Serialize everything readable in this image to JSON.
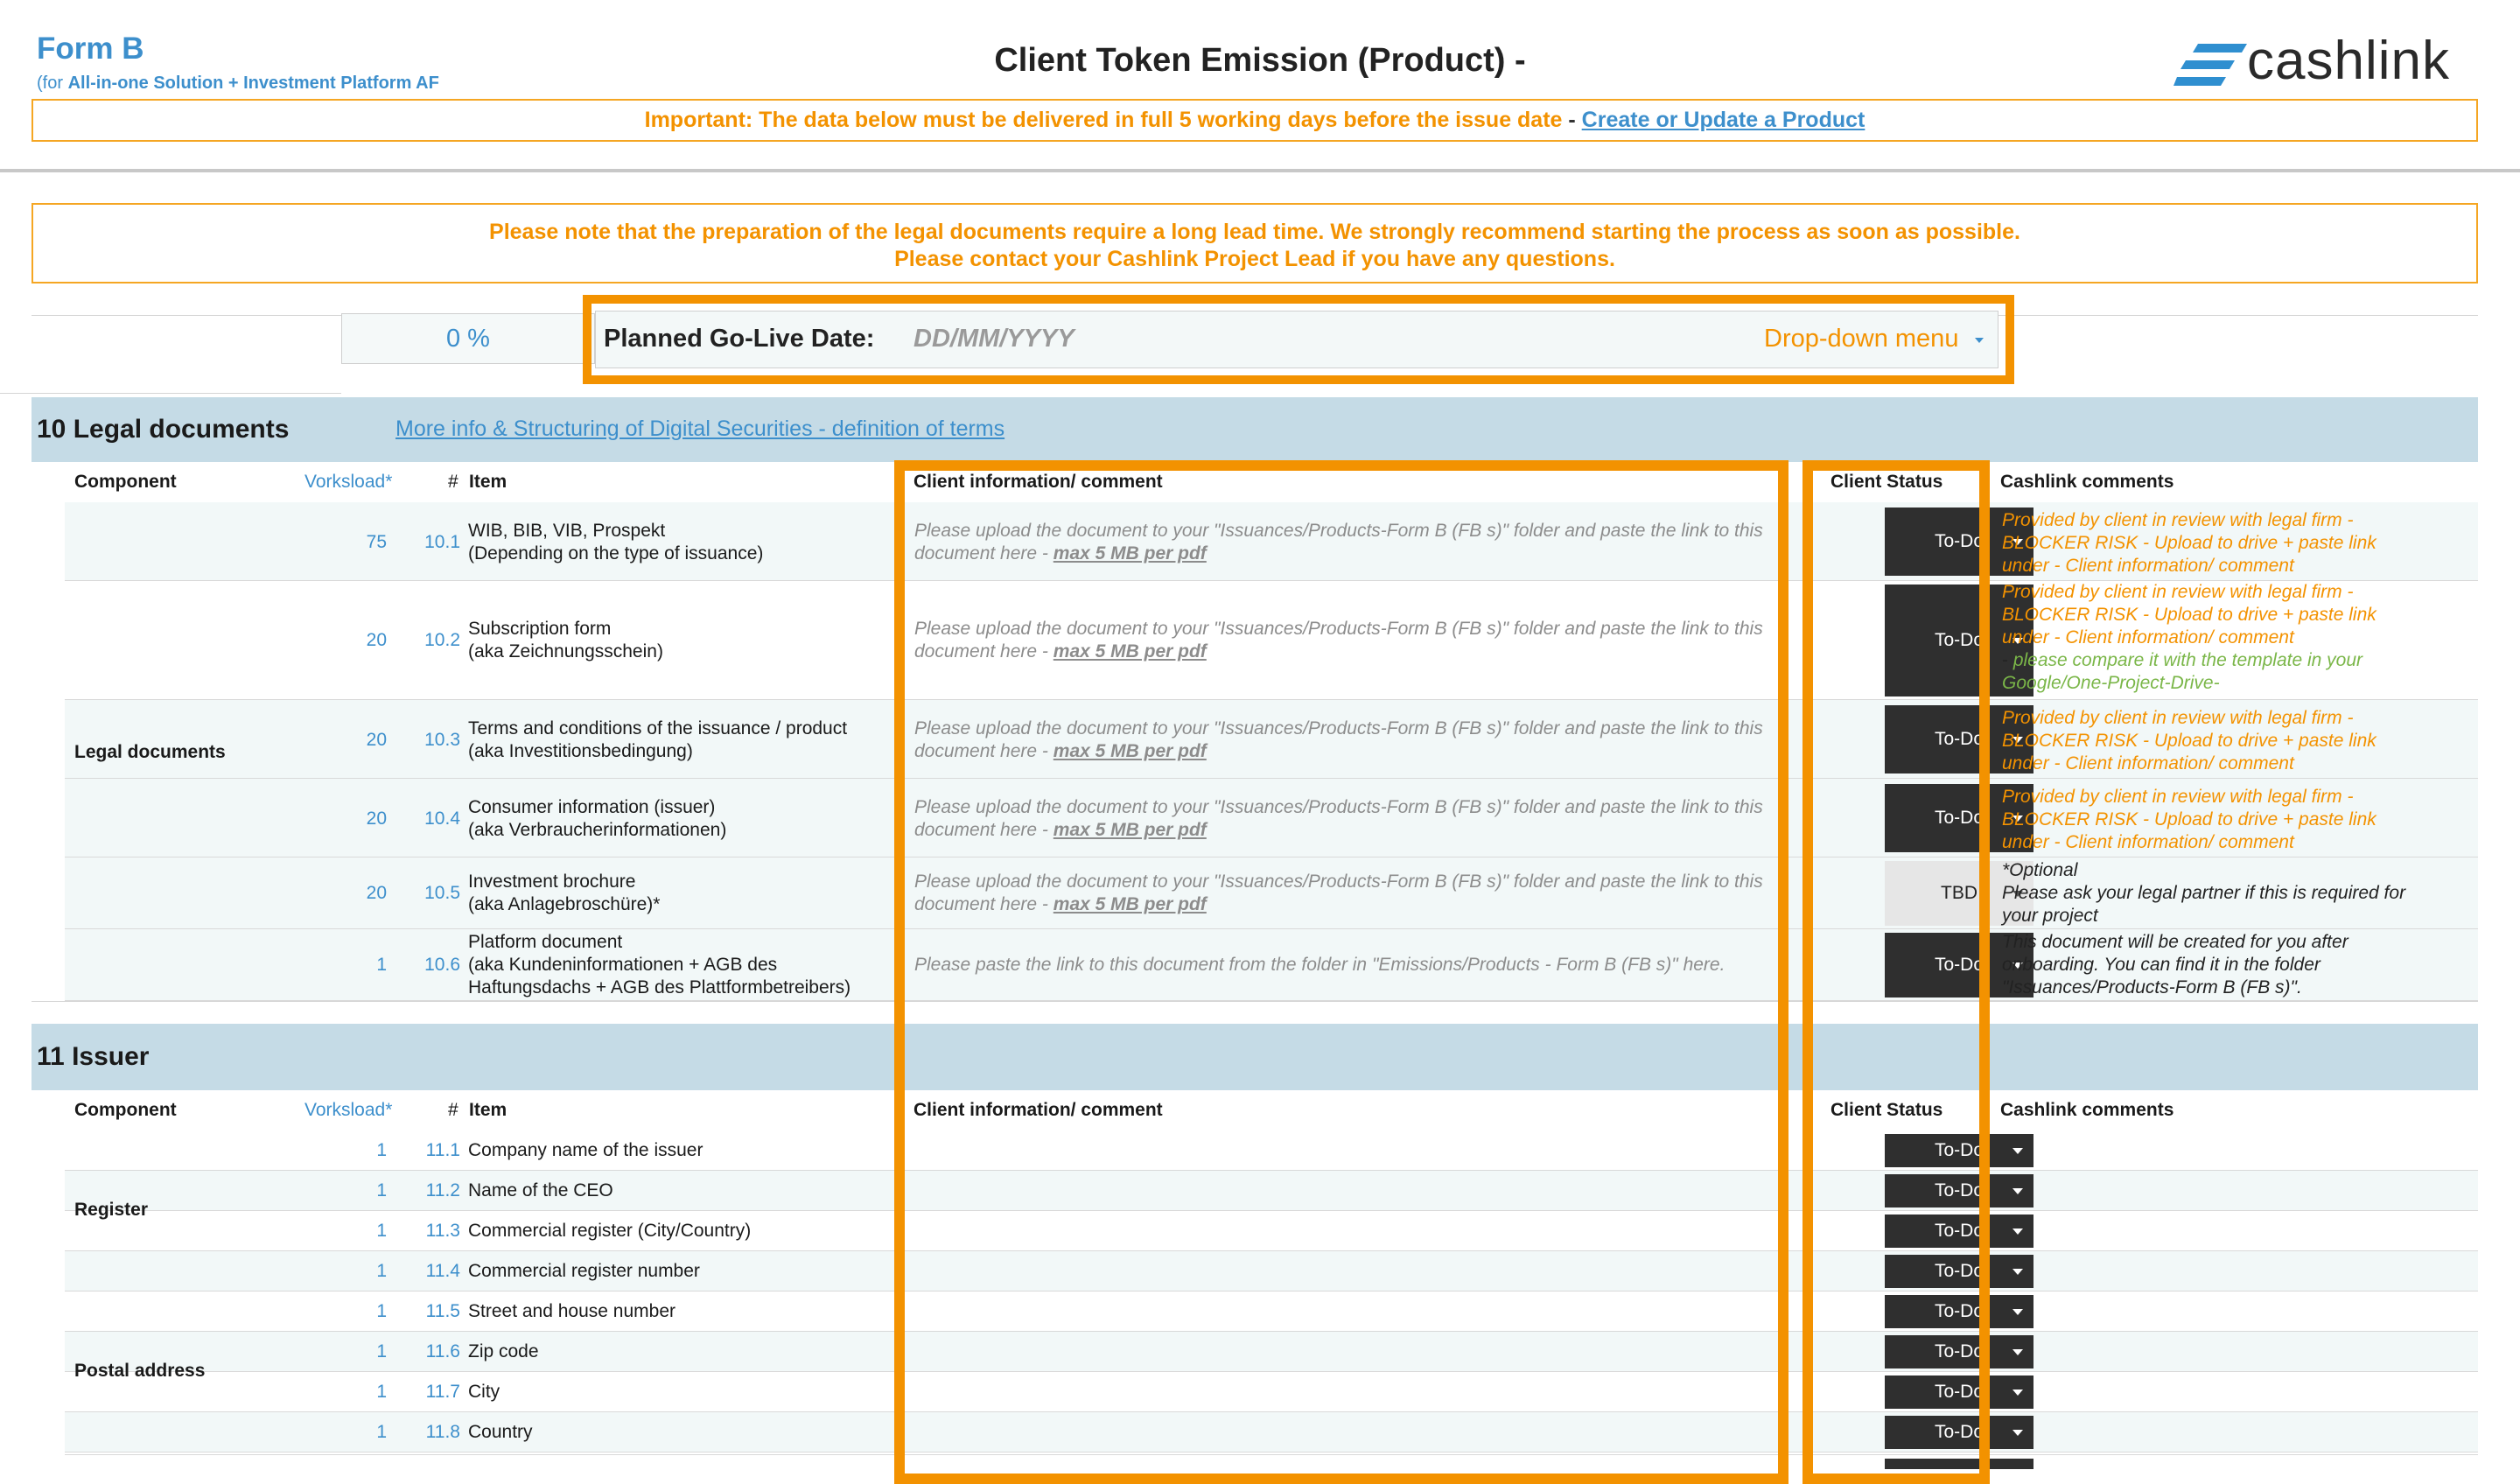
{
  "header": {
    "form_label": "Form B",
    "form_sub_prefix": "(for ",
    "form_sub_bold": "All-in-one Solution + Investment Platform AF",
    "title": "Client Token Emission (Product) -",
    "logo_text": "cashlink",
    "important_text": "Important: The data below must be delivered in full 5 working days before the issue date",
    "important_dash": " - ",
    "important_link": "Create or Update a Product"
  },
  "note": {
    "line1": "Please note that the preparation of the legal documents require a long lead time. We strongly recommend starting the process as soon as possible.",
    "line2": "Please contact your Cashlink Project Lead if you have any questions."
  },
  "golive": {
    "percent": "0 %",
    "label": "Planned Go-Live Date:",
    "date_placeholder": "DD/MM/YYYY",
    "dropdown_label": "Drop-down menu"
  },
  "columns": {
    "component": "Component",
    "workload": "Vorksload*",
    "hash": "#",
    "item": "Item",
    "client_info": "Client information/ comment",
    "client_status": "Client Status",
    "cashlink_comments": "Cashlink comments"
  },
  "section10": {
    "number": "10",
    "title": "Legal documents",
    "link": "More info & Structuring of Digital Securities - definition of terms",
    "component": "Legal documents",
    "upload_text": "Please upload the document to your \"Issuances/Products-Form B (FB s)\" folder and paste the link to this",
    "upload_text2": "document here - ",
    "upload_limit": "max 5 MB per pdf",
    "paste_text": "Please paste the link to this document from the folder in \"Emissions/Products - Form B (FB s)\" here.",
    "rows": [
      {
        "w": "75",
        "id": "10.1",
        "item1": "WIB, BIB, VIB, Prospekt",
        "item2": "(Depending on the type of issuance)",
        "status": "To-Do"
      },
      {
        "w": "20",
        "id": "10.2",
        "item1": "Subscription form",
        "item2": "(aka Zeichnungsschein)",
        "status": "To-Do"
      },
      {
        "w": "20",
        "id": "10.3",
        "item1": "Terms and conditions of the issuance / product",
        "item2": "(aka Investitionsbedingung)",
        "status": "To-Do"
      },
      {
        "w": "20",
        "id": "10.4",
        "item1": "Consumer information (issuer)",
        "item2": "(aka Verbraucherinformationen)",
        "status": "To-Do"
      },
      {
        "w": "20",
        "id": "10.5",
        "item1": "Investment brochure",
        "item2": "(aka Anlagebroschüre)*",
        "status": "TBD"
      },
      {
        "w": "1",
        "id": "10.6",
        "item1": "Platform document",
        "item2": "(aka Kundeninformationen + AGB des",
        "item3": "Haftungsdachs + AGB des Plattformbetreibers)",
        "status": "To-Do"
      }
    ],
    "blocker_l1": "Provided by client in review with legal firm -",
    "blocker_l2": "BLOCKER RISK - Upload to drive + paste link",
    "blocker_l3": "under - Client information/ comment",
    "compare_dash": "- ",
    "compare_l1": "please compare it with the template in your",
    "compare_l2": "Google/One-Project-Drive-",
    "optional_l1": "*Optional",
    "optional_l2": "Please ask your legal partner if this is required for",
    "optional_l3": "your project",
    "onboard_l1": "This document will be created for you after",
    "onboard_l2": "onboarding. You can find it in the folder",
    "onboard_l3": "\"Issuances/Products-Form B (FB s)\"."
  },
  "section11": {
    "number": "11",
    "title": "Issuer",
    "component_register": "Register",
    "component_postal": "Postal address",
    "rows": [
      {
        "w": "1",
        "id": "11.1",
        "item": "Company name of the issuer",
        "status": "To-Do"
      },
      {
        "w": "1",
        "id": "11.2",
        "item": "Name of the CEO",
        "status": "To-Do"
      },
      {
        "w": "1",
        "id": "11.3",
        "item": "Commercial register (City/Country)",
        "status": "To-Do"
      },
      {
        "w": "1",
        "id": "11.4",
        "item": "Commercial register number",
        "status": "To-Do"
      },
      {
        "w": "1",
        "id": "11.5",
        "item": "Street and house number",
        "status": "To-Do"
      },
      {
        "w": "1",
        "id": "11.6",
        "item": "Zip code",
        "status": "To-Do"
      },
      {
        "w": "1",
        "id": "11.7",
        "item": "City",
        "status": "To-Do"
      },
      {
        "w": "1",
        "id": "11.8",
        "item": "Country",
        "status": "To-Do"
      }
    ]
  },
  "colors": {
    "accent_orange": "#f39200",
    "link_blue": "#3d8fcc",
    "section_band": "#c5dbe6",
    "status_dark": "#2f2f2f"
  }
}
